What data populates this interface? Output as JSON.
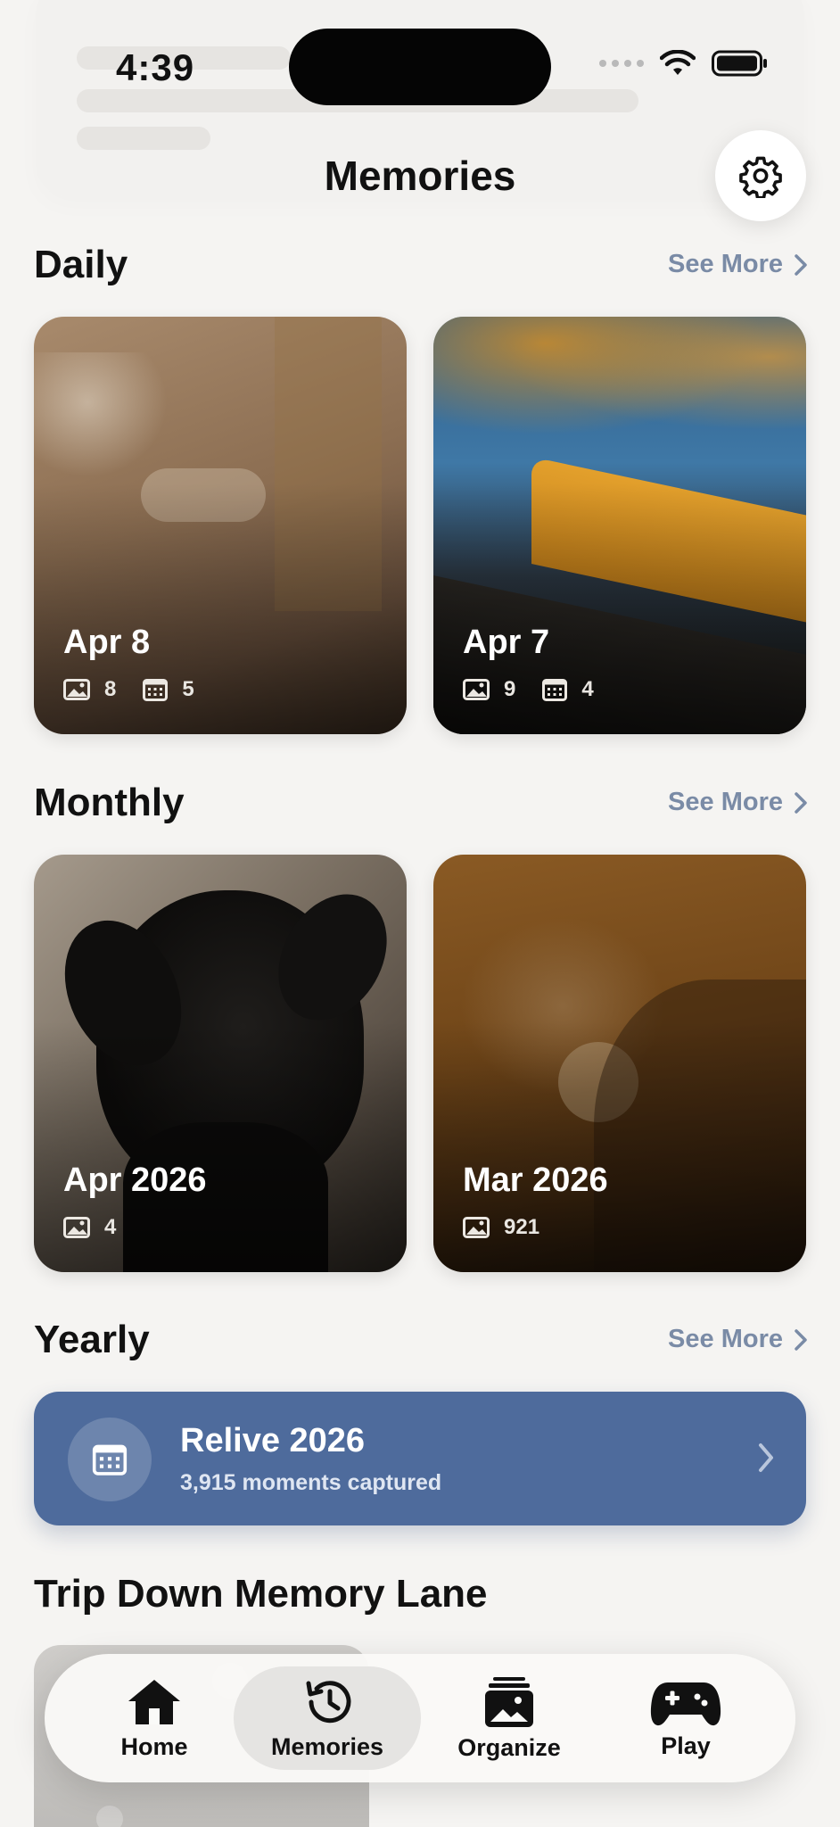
{
  "status_bar": {
    "time": "4:39"
  },
  "header": {
    "title": "Memories"
  },
  "sections": {
    "daily": {
      "title": "Daily",
      "see_more": "See More",
      "cards": [
        {
          "title": "Apr 8",
          "photos": "8",
          "events": "5"
        },
        {
          "title": "Apr 7",
          "photos": "9",
          "events": "4"
        }
      ]
    },
    "monthly": {
      "title": "Monthly",
      "see_more": "See More",
      "cards": [
        {
          "title": "Apr 2026",
          "photos": "4"
        },
        {
          "title": "Mar 2026",
          "photos": "921"
        }
      ]
    },
    "yearly": {
      "title": "Yearly",
      "see_more": "See More",
      "banner": {
        "title": "Relive 2026",
        "subtitle": "3,915 moments captured"
      }
    },
    "trip": {
      "title": "Trip Down Memory Lane"
    }
  },
  "tabbar": {
    "tabs": [
      {
        "label": "Home",
        "icon": "house-icon"
      },
      {
        "label": "Memories",
        "icon": "history-clock-icon",
        "active": true
      },
      {
        "label": "Organize",
        "icon": "photo-stack-icon"
      },
      {
        "label": "Play",
        "icon": "gamepad-icon"
      }
    ]
  },
  "colors": {
    "background": "#f5f4f2",
    "accent_link": "#7a8ba6",
    "yearly_banner": "#4e6b9c"
  }
}
